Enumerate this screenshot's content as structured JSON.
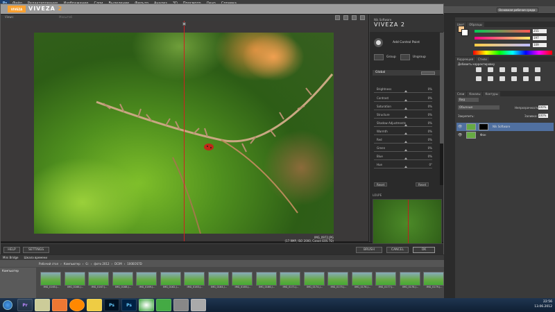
{
  "ps": {
    "logo": "Ps",
    "menu": [
      "Файл",
      "Редактирование",
      "Изображение",
      "Слои",
      "Выделение",
      "Фильтр",
      "Анализ",
      "3D",
      "Просмотр",
      "Окно",
      "Справка"
    ],
    "workspace": "Основная рабочая среда"
  },
  "viveza": {
    "logo": "VIVEZA",
    "title": "VIVEZA",
    "title_num": "2",
    "toolbar": {
      "views": "Views:",
      "zoom": "Масштаб"
    },
    "image_info": [
      "IMG_0972.JPG",
      "(17.9MP, ISO 2000, Canon EOS 7D)"
    ],
    "panel": {
      "nik": "Nik Software",
      "product": "VIVEZA 2",
      "add_cp": "Add Control Point",
      "group": "Group",
      "ungroup": "Ungroup",
      "global": "Global",
      "sliders": [
        {
          "label": "Brightness",
          "value": "0%"
        },
        {
          "label": "Contrast",
          "value": "0%"
        },
        {
          "label": "Saturation",
          "value": "0%"
        },
        {
          "label": "Structure",
          "value": "0%"
        },
        {
          "label": "Shadow Adjustments",
          "value": "0%"
        },
        {
          "label": "Warmth",
          "value": "0%"
        },
        {
          "label": "Red",
          "value": "0%"
        },
        {
          "label": "Green",
          "value": "0%"
        },
        {
          "label": "Blue",
          "value": "0%"
        },
        {
          "label": "Hue",
          "value": "0°"
        }
      ],
      "reset_left": "Reset",
      "reset_right": "Reset",
      "loupe": "LOUPE"
    },
    "bottom": {
      "help": "HELP",
      "settings": "SETTINGS",
      "brush": "BRUSH",
      "cancel": "CANCEL",
      "ok": "OK"
    }
  },
  "ps_panels": {
    "color_tabs": [
      "Цвет",
      "Образцы"
    ],
    "color_values": [
      "255",
      "197",
      "109"
    ],
    "adj_tabs": [
      "Коррекция",
      "Стили"
    ],
    "adj_title": "Добавить корректировку",
    "layer_tabs": [
      "Слои",
      "Каналы",
      "Контуры"
    ],
    "kind": "Вид",
    "blend": "Обычные",
    "opacity_label": "Непрозрачность:",
    "opacity": "100%",
    "lock_label": "Закрепить:",
    "fill_label": "Заливка:",
    "fill": "100%",
    "layers": [
      {
        "name": "Nik Software"
      },
      {
        "name": "Фон"
      }
    ]
  },
  "bridge": {
    "tabs": [
      "Mini Bridge",
      "Шкала времени"
    ],
    "path": [
      "Рабочий стол",
      "Компьютер",
      "G:",
      "фото 2012",
      "DCIM",
      "100EOS7D"
    ],
    "left_label": "Компьютер",
    "thumbs": [
      "IMG_0165.J...",
      "IMG_0166.J...",
      "IMG_0167.J...",
      "IMG_0168.J...",
      "IMG_0169.J...",
      "IMG_0162.J...",
      "IMG_0163.J...",
      "IMG_0164.J...",
      "IMG_0165.J...",
      "IMG_0166.J...",
      "IMG_0171.J...",
      "IMG_0174.J...",
      "IMG_0175.J...",
      "IMG_0176.J...",
      "IMG_0177.J...",
      "IMG_0178.J...",
      "IMG_0179.J..."
    ]
  },
  "taskbar": {
    "apps": [
      "Pr",
      "",
      "",
      "",
      "",
      "Ps",
      "Ps",
      "",
      "",
      "",
      ""
    ],
    "time": "22:56",
    "date": "13.06.2012"
  }
}
